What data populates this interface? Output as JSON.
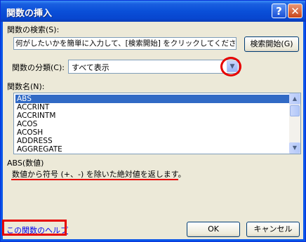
{
  "window": {
    "title": "関数の挿入",
    "help_glyph": "?",
    "close_glyph": "✕"
  },
  "search": {
    "label": "関数の検索(S):",
    "value": "何がしたいかを簡単に入力して、[検索開始] をクリックしてください。",
    "button": "検索開始(G)"
  },
  "category": {
    "label": "関数の分類(C):",
    "selected": "すべて表示"
  },
  "function_list": {
    "label": "関数名(N):",
    "items": [
      "ABS",
      "ACCRINT",
      "ACCRINTM",
      "ACOS",
      "ACOSH",
      "ADDRESS",
      "AGGREGATE"
    ],
    "selected_index": 0
  },
  "description": {
    "signature": "ABS(数値)",
    "text": "数値から符号 (+、-) を除いた絶対値を返します。"
  },
  "footer": {
    "help_link": "この関数のヘルプ",
    "ok": "OK",
    "cancel": "キャンセル"
  },
  "colors": {
    "annotation_red": "#e60000",
    "selection_blue": "#316ac5"
  }
}
